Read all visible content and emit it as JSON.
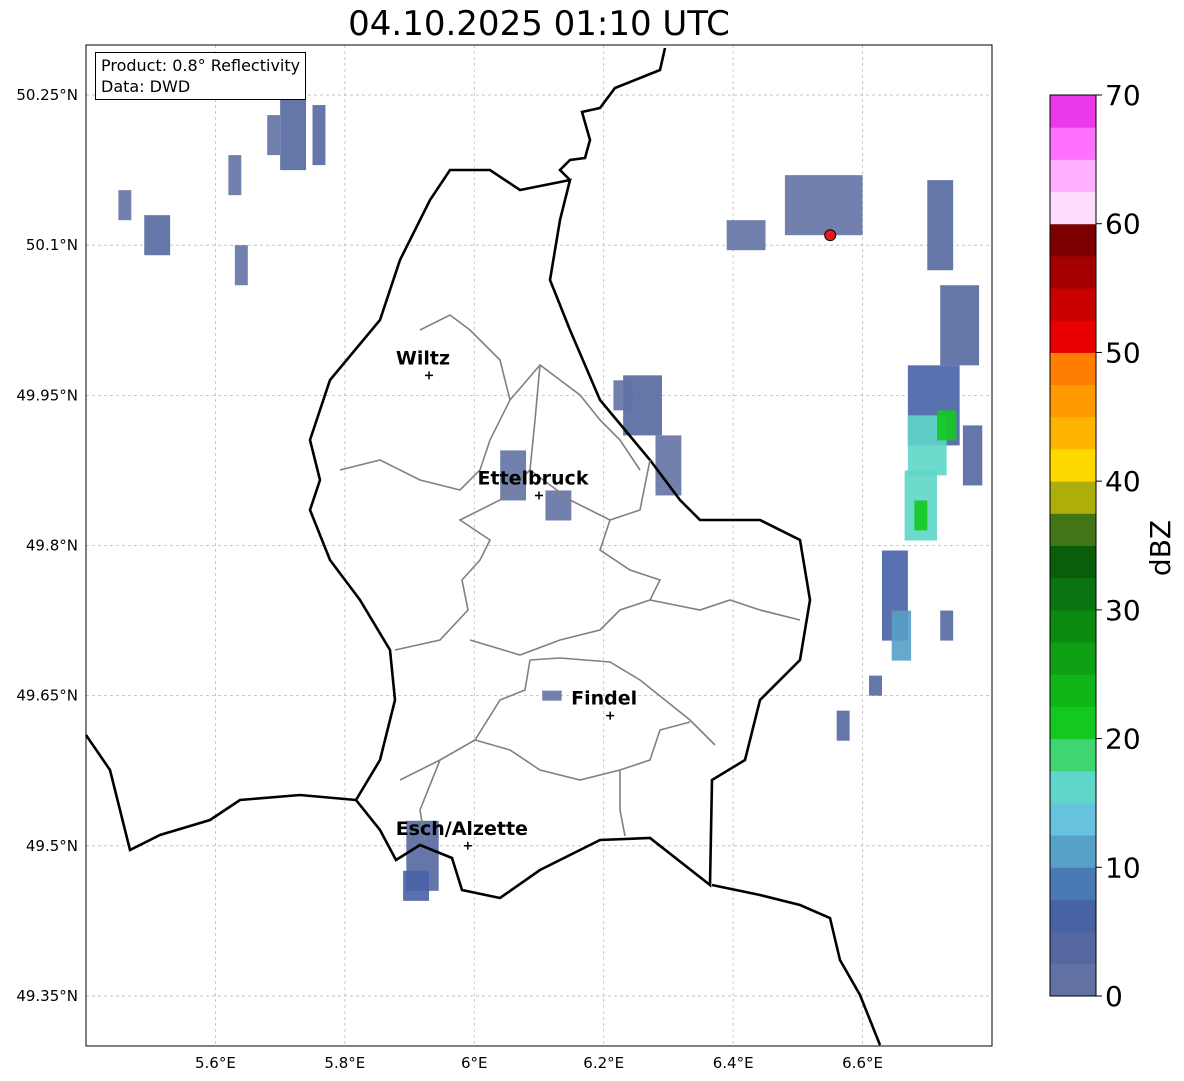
{
  "title": "04.10.2025 01:10 UTC",
  "info": {
    "product": "Product: 0.8° Reflectivity",
    "data": "Data: DWD"
  },
  "map": {
    "lon_range": [
      5.4,
      6.8
    ],
    "lat_range": [
      49.3,
      50.3
    ],
    "lon_ticks": [
      {
        "value": 5.6,
        "label": "5.6°E"
      },
      {
        "value": 5.8,
        "label": "5.8°E"
      },
      {
        "value": 6.0,
        "label": "6°E"
      },
      {
        "value": 6.2,
        "label": "6.2°E"
      },
      {
        "value": 6.4,
        "label": "6.4°E"
      },
      {
        "value": 6.6,
        "label": "6.6°E"
      }
    ],
    "lat_ticks": [
      {
        "value": 49.35,
        "label": "49.35°N"
      },
      {
        "value": 49.5,
        "label": "49.5°N"
      },
      {
        "value": 49.65,
        "label": "49.65°N"
      },
      {
        "value": 49.8,
        "label": "49.8°N"
      },
      {
        "value": 49.95,
        "label": "49.95°N"
      },
      {
        "value": 50.1,
        "label": "50.1°N"
      },
      {
        "value": 50.25,
        "label": "50.25°N"
      }
    ],
    "cities": [
      {
        "name": "Wiltz",
        "lon": 5.93,
        "lat": 49.97
      },
      {
        "name": "Ettelbruck",
        "lon": 6.1,
        "lat": 49.85
      },
      {
        "name": "Findel",
        "lon": 6.21,
        "lat": 49.63
      },
      {
        "name": "Esch/Alzette",
        "lon": 5.99,
        "lat": 49.5
      }
    ],
    "radar_site": {
      "lon": 6.55,
      "lat": 50.11,
      "color": "#e41a1c"
    },
    "gridline_color": "#bbbbbb"
  },
  "colorbar": {
    "label": "dBZ",
    "vmin": 0,
    "vmax": 70,
    "ticks": [
      {
        "value": 0,
        "label": "0"
      },
      {
        "value": 10,
        "label": "10"
      },
      {
        "value": 20,
        "label": "20"
      },
      {
        "value": 30,
        "label": "30"
      },
      {
        "value": 40,
        "label": "40"
      },
      {
        "value": 50,
        "label": "50"
      },
      {
        "value": 60,
        "label": "60"
      },
      {
        "value": 70,
        "label": "70"
      }
    ],
    "colors": [
      "#6272a4",
      "#54679f",
      "#4862a6",
      "#4a7ab5",
      "#57a0c8",
      "#66c2dd",
      "#5ed6c8",
      "#3fd672",
      "#13c920",
      "#10b618",
      "#0f9f15",
      "#0b8a10",
      "#0a7510",
      "#0a5e0a",
      "#437415",
      "#adae0a",
      "#ffd800",
      "#ffb400",
      "#ff9a00",
      "#ff7d00",
      "#e80000",
      "#c80000",
      "#a40000",
      "#7c0000",
      "#ffddff",
      "#ffb0ff",
      "#ff70ff",
      "#ea38ea"
    ]
  },
  "radar_cells": [
    {
      "lon": 5.72,
      "lat": 50.22,
      "w": 0.04,
      "h": 0.09,
      "dbz": 3
    },
    {
      "lon": 5.69,
      "lat": 50.21,
      "w": 0.02,
      "h": 0.04,
      "dbz": 2
    },
    {
      "lon": 5.76,
      "lat": 50.21,
      "w": 0.02,
      "h": 0.06,
      "dbz": 3
    },
    {
      "lon": 5.51,
      "lat": 50.11,
      "w": 0.04,
      "h": 0.04,
      "dbz": 3
    },
    {
      "lon": 5.46,
      "lat": 50.14,
      "w": 0.02,
      "h": 0.03,
      "dbz": 2
    },
    {
      "lon": 5.63,
      "lat": 50.17,
      "w": 0.02,
      "h": 0.04,
      "dbz": 2
    },
    {
      "lon": 5.64,
      "lat": 50.08,
      "w": 0.02,
      "h": 0.04,
      "dbz": 2
    },
    {
      "lon": 6.06,
      "lat": 49.87,
      "w": 0.04,
      "h": 0.05,
      "dbz": 2
    },
    {
      "lon": 6.13,
      "lat": 49.84,
      "w": 0.04,
      "h": 0.03,
      "dbz": 2
    },
    {
      "lon": 6.26,
      "lat": 49.94,
      "w": 0.06,
      "h": 0.06,
      "dbz": 3
    },
    {
      "lon": 6.3,
      "lat": 49.88,
      "w": 0.04,
      "h": 0.06,
      "dbz": 2
    },
    {
      "lon": 6.23,
      "lat": 49.95,
      "w": 0.03,
      "h": 0.03,
      "dbz": 2
    },
    {
      "lon": 6.12,
      "lat": 49.65,
      "w": 0.03,
      "h": 0.01,
      "dbz": 2
    },
    {
      "lon": 5.92,
      "lat": 49.49,
      "w": 0.05,
      "h": 0.07,
      "dbz": 4
    },
    {
      "lon": 5.91,
      "lat": 49.46,
      "w": 0.04,
      "h": 0.03,
      "dbz": 6
    },
    {
      "lon": 6.72,
      "lat": 50.12,
      "w": 0.04,
      "h": 0.09,
      "dbz": 4
    },
    {
      "lon": 6.75,
      "lat": 50.02,
      "w": 0.06,
      "h": 0.08,
      "dbz": 3
    },
    {
      "lon": 6.71,
      "lat": 49.94,
      "w": 0.08,
      "h": 0.08,
      "dbz": 5
    },
    {
      "lon": 6.7,
      "lat": 49.9,
      "w": 0.06,
      "h": 0.06,
      "dbz": 15
    },
    {
      "lon": 6.73,
      "lat": 49.92,
      "w": 0.03,
      "h": 0.03,
      "dbz": 21
    },
    {
      "lon": 6.69,
      "lat": 49.84,
      "w": 0.05,
      "h": 0.07,
      "dbz": 17
    },
    {
      "lon": 6.69,
      "lat": 49.83,
      "w": 0.02,
      "h": 0.03,
      "dbz": 22
    },
    {
      "lon": 6.77,
      "lat": 49.89,
      "w": 0.03,
      "h": 0.06,
      "dbz": 4
    },
    {
      "lon": 6.65,
      "lat": 49.75,
      "w": 0.04,
      "h": 0.09,
      "dbz": 6
    },
    {
      "lon": 6.66,
      "lat": 49.71,
      "w": 0.03,
      "h": 0.05,
      "dbz": 10
    },
    {
      "lon": 6.73,
      "lat": 49.72,
      "w": 0.02,
      "h": 0.03,
      "dbz": 3
    },
    {
      "lon": 6.62,
      "lat": 49.66,
      "w": 0.02,
      "h": 0.02,
      "dbz": 3
    },
    {
      "lon": 6.57,
      "lat": 49.62,
      "w": 0.02,
      "h": 0.03,
      "dbz": 3
    },
    {
      "lon": 6.54,
      "lat": 50.14,
      "w": 0.12,
      "h": 0.06,
      "dbz": 1
    },
    {
      "lon": 6.42,
      "lat": 50.11,
      "w": 0.06,
      "h": 0.03,
      "dbz": 1
    }
  ]
}
